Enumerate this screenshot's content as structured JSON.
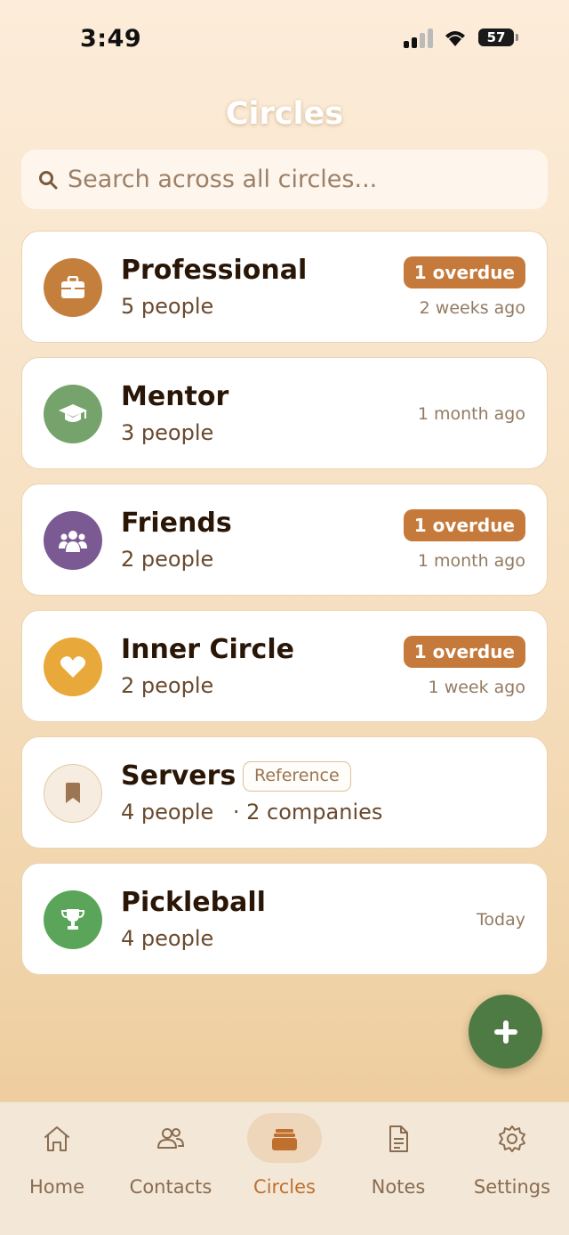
{
  "status_bar": {
    "time": "3:49",
    "battery": "57"
  },
  "page": {
    "title": "Circles"
  },
  "search": {
    "placeholder": "Search across all circles..."
  },
  "circles": [
    {
      "name": "Professional",
      "count": "5 people",
      "overdue": "1 overdue",
      "last": "2 weeks ago",
      "icon": "briefcase-icon",
      "color": "#c47f3d"
    },
    {
      "name": "Mentor",
      "count": "3 people",
      "last": "1 month ago",
      "icon": "graduation-cap-icon",
      "color": "#75a36b"
    },
    {
      "name": "Friends",
      "count": "2 people",
      "overdue": "1 overdue",
      "last": "1 month ago",
      "icon": "people-group-icon",
      "color": "#7b5a94"
    },
    {
      "name": "Inner Circle",
      "count": "2 people",
      "overdue": "1 overdue",
      "last": "1 week ago",
      "icon": "heart-icon",
      "color": "#e8a93a"
    },
    {
      "name": "Servers",
      "badge": "Reference",
      "count": "4 people",
      "companies": "· 2 companies",
      "icon": "bookmark-icon",
      "color": "#f6ece0"
    },
    {
      "name": "Pickleball",
      "count": "4 people",
      "last": "Today",
      "icon": "trophy-icon",
      "color": "#5ba55a"
    }
  ],
  "tabs": [
    {
      "label": "Home",
      "icon": "home-icon"
    },
    {
      "label": "Contacts",
      "icon": "contacts-icon"
    },
    {
      "label": "Circles",
      "icon": "circles-icon",
      "active": true
    },
    {
      "label": "Notes",
      "icon": "notes-icon"
    },
    {
      "label": "Settings",
      "icon": "settings-icon"
    }
  ],
  "colors": {
    "accent": "#c0702e",
    "fab": "#4e7a44",
    "overdue": "#c57a3b"
  }
}
